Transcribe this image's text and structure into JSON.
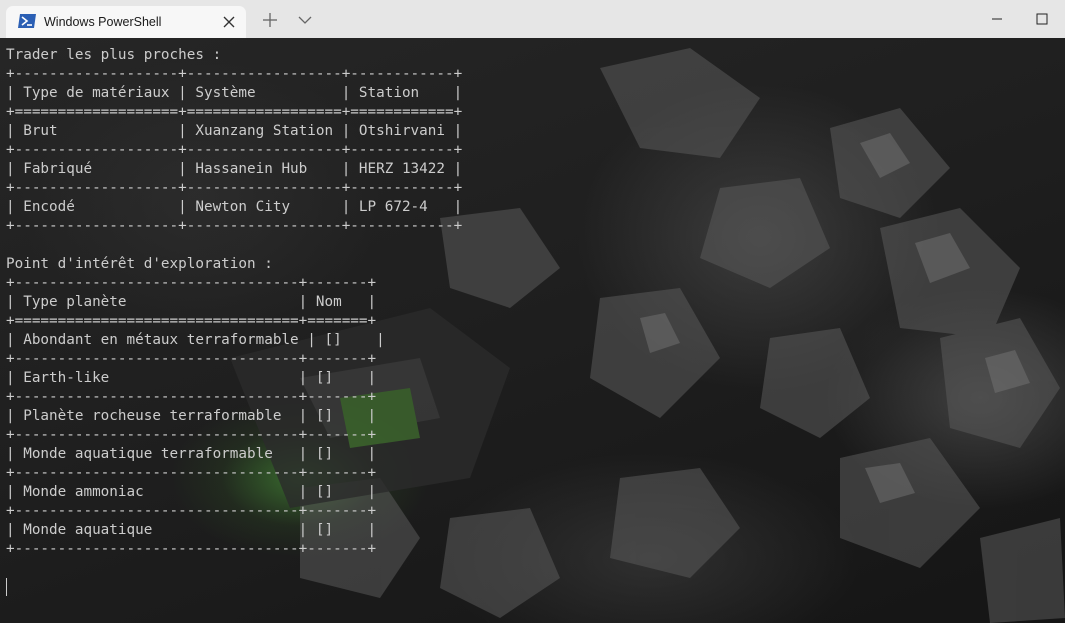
{
  "window": {
    "tab_title": "Windows PowerShell",
    "tab_icon": "powershell-icon",
    "close_tab_icon": "close-icon",
    "new_tab_icon": "plus-icon",
    "dropdown_icon": "chevron-down-icon",
    "minimize_icon": "minimize-icon",
    "maximize_icon": "maximize-icon",
    "accent_color": "#2b5fb4"
  },
  "terminal": {
    "lines": [
      "Trader les plus proches :",
      "+-------------------+------------------+------------+",
      "| Type de matériaux | Système          | Station    |",
      "+===================+==================+============+",
      "| Brut              | Xuanzang Station | Otshirvani |",
      "+-------------------+------------------+------------+",
      "| Fabriqué          | Hassanein Hub    | HERZ 13422 |",
      "+-------------------+------------------+------------+",
      "| Encodé            | Newton City      | LP 672-4   |",
      "+-------------------+------------------+------------+",
      "",
      "Point d'intérêt d'exploration :",
      "+---------------------------------+-------+",
      "| Type planète                    | Nom   |",
      "+=================================+=======+",
      "| Abondant en métaux terraformable | []    |",
      "+---------------------------------+-------+",
      "| Earth-like                      | []    |",
      "+---------------------------------+-------+",
      "| Planète rocheuse terraformable  | []    |",
      "+---------------------------------+-------+",
      "| Monde aquatique terraformable   | []    |",
      "+---------------------------------+-------+",
      "| Monde ammoniac                  | []    |",
      "+---------------------------------+-------+",
      "| Monde aquatique                 | []    |",
      "+---------------------------------+-------+"
    ]
  }
}
